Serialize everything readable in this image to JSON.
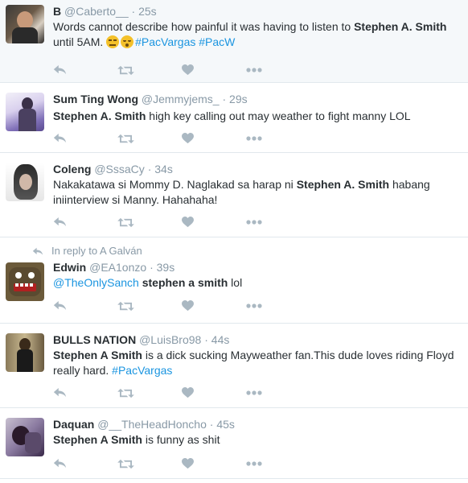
{
  "tweets": [
    {
      "name": "B",
      "handle": "@Caberto__",
      "dot": "·",
      "time": "25s",
      "text_parts": [
        "Words cannot describe how painful it was having to listen to ",
        "Stephen A. Smith",
        " until 5AM. "
      ],
      "hashtags": [
        "#PacVargas",
        "#PacW"
      ],
      "emojis": [
        "unamused-face-emoji",
        "sleepy-face-emoji"
      ]
    },
    {
      "name": "Sum Ting Wong",
      "handle": "@Jemmyjems_",
      "dot": "·",
      "time": "29s",
      "bold": "Stephen A. Smith",
      "rest": " high key calling out may weather to fight manny LOL"
    },
    {
      "name": "Coleng",
      "handle": "@SssaCy",
      "dot": "·",
      "time": "34s",
      "pre": "Nakakatawa si Mommy D. Naglakad sa harap ni ",
      "bold": "Stephen A. Smith",
      "post": " habang iniinterview si Manny. Hahahaha!"
    },
    {
      "reply_context": "In reply to A Galván",
      "name": "Edwin",
      "handle": "@EA1onzo",
      "dot": "·",
      "time": "39s",
      "mention": "@TheOnlySanch",
      "bold": " stephen a smith",
      "rest": " lol"
    },
    {
      "name": "BULLS NATION",
      "handle": "@LuisBro98",
      "dot": "·",
      "time": "44s",
      "bold": "Stephen A Smith",
      "rest": " is a dick sucking Mayweather fan.This dude loves riding Floyd really hard. ",
      "hashtag": "#PacVargas"
    },
    {
      "name": "Daquan",
      "handle": "@__TheHeadHoncho",
      "dot": "·",
      "time": "45s",
      "bold": "Stephen A Smith",
      "rest": " is funny as shit"
    }
  ],
  "colors": {
    "link": "#1b95e0",
    "muted": "#8899a6",
    "text": "#292f33",
    "highlight_bg": "#f5f8fa",
    "divider": "#e1e8ed"
  },
  "action_icons": [
    "reply-icon",
    "retweet-icon",
    "like-icon",
    "more-icon"
  ]
}
